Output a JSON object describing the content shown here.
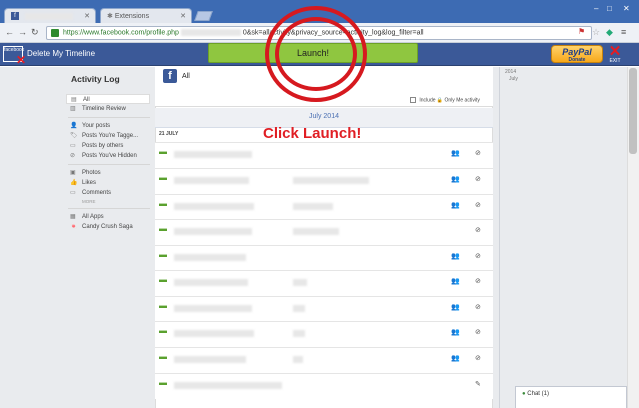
{
  "browser": {
    "tabs": [
      {
        "label": "",
        "icon": "facebook-icon"
      },
      {
        "label": "Extensions",
        "icon": "puzzle-icon"
      }
    ],
    "url_prefix": "https://www.facebook.com/profile.php",
    "url_suffix": "0&sk=allactivity&privacy_source=activity_log&log_filter=all",
    "window_controls": [
      "–",
      "□",
      "✕"
    ]
  },
  "extension": {
    "title": "Delete My Timeline",
    "icon_label": "facebook",
    "launch_label": "Launch!",
    "paypal_label": "PayPal",
    "paypal_sub": "Donate",
    "exit_label": "EXIT"
  },
  "sidebar": {
    "title": "Activity Log",
    "groups": [
      [
        {
          "label": "All",
          "icon": "list-icon",
          "selected": true
        },
        {
          "label": "Timeline Review",
          "icon": "timeline-icon"
        }
      ],
      [
        {
          "label": "Your posts",
          "icon": "person-icon"
        },
        {
          "label": "Posts You're Tagge...",
          "icon": "tag-icon"
        },
        {
          "label": "Posts by others",
          "icon": "comment-icon"
        },
        {
          "label": "Posts You've Hidden",
          "icon": "hidden-icon"
        }
      ],
      [
        {
          "label": "Photos",
          "icon": "photo-icon"
        },
        {
          "label": "Likes",
          "icon": "like-icon"
        },
        {
          "label": "Comments",
          "icon": "comment-icon"
        },
        {
          "label": "MORE",
          "icon": "",
          "more": true
        }
      ],
      [
        {
          "label": "All Apps",
          "icon": "apps-icon"
        },
        {
          "label": "Candy Crush Saga",
          "icon": "candy-icon"
        }
      ]
    ]
  },
  "main": {
    "filter_label": "All",
    "include_label": "Include",
    "include_only_me": "Only Me activity",
    "month_label": "July 2014",
    "date_header": "21 JULY",
    "annotation": "Click Launch!"
  },
  "timeline": {
    "year": "2014",
    "month": "July"
  },
  "chat": {
    "label": "Chat (1)"
  }
}
